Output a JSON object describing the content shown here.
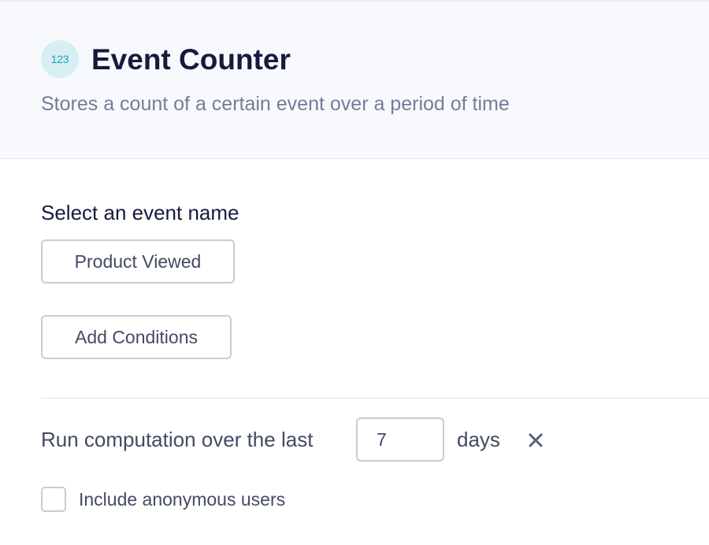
{
  "header": {
    "badge_text": "123",
    "title": "Event Counter",
    "subtitle": "Stores a count of a certain event over a period of time"
  },
  "event_section": {
    "label": "Select an event name",
    "selected_event": "Product Viewed",
    "add_conditions_label": "Add Conditions"
  },
  "computation": {
    "prefix_label": "Run computation over the last",
    "days_value": "7",
    "suffix_label": "days",
    "remove_icon": "close-icon"
  },
  "anonymous": {
    "label": "Include anonymous users",
    "checked": false
  },
  "colors": {
    "badge_bg": "#d7eff3",
    "badge_text": "#17a4bd",
    "title": "#141b3d",
    "subtitle": "#757c99",
    "header_bg": "#f8f9fd",
    "border": "#c9ccd6"
  }
}
